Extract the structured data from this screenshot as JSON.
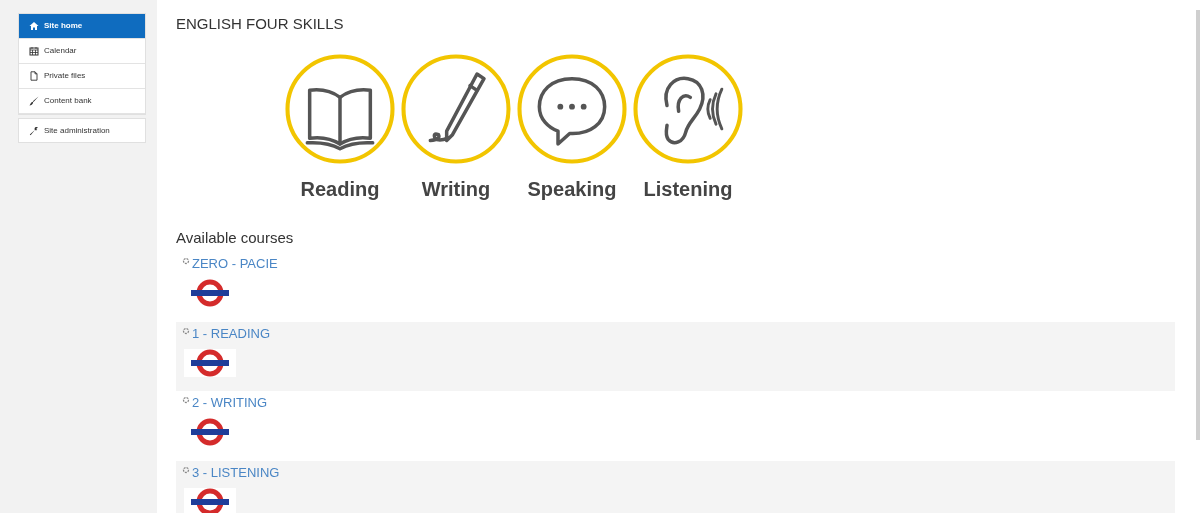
{
  "nav": [
    {
      "label": "Site home",
      "kind": "home",
      "selected": true
    },
    {
      "label": "Calendar",
      "kind": "calendar",
      "selected": false
    },
    {
      "label": "Private files",
      "kind": "file",
      "selected": false
    },
    {
      "label": "Content bank",
      "kind": "brush",
      "selected": false
    }
  ],
  "admin": {
    "label": "Site administration"
  },
  "page_title": "ENGLISH FOUR SKILLS",
  "skills": [
    {
      "label": "Reading",
      "kind": "book"
    },
    {
      "label": "Writing",
      "kind": "pen"
    },
    {
      "label": "Speaking",
      "kind": "speech"
    },
    {
      "label": "Listening",
      "kind": "ear"
    }
  ],
  "courses_heading": "Available courses",
  "courses": [
    {
      "title": "ZERO - PACIE"
    },
    {
      "title": "1 - READING"
    },
    {
      "title": "2 - WRITING"
    },
    {
      "title": "3 - LISTENING"
    }
  ]
}
